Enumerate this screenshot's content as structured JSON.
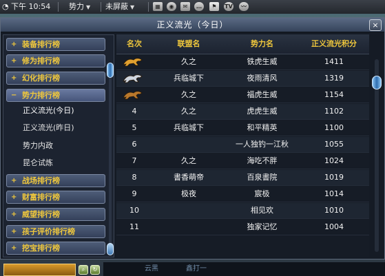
{
  "topbar": {
    "time": "下午 10:54",
    "faction": "势力",
    "status": "未屏蔽",
    "icons": [
      "keyboard-icon",
      "settings-icon",
      "mail-icon",
      "chat-icon",
      "pvp-icon",
      "tv-icon",
      "wave-icon"
    ],
    "icon_texts": {
      "tv": "TV"
    }
  },
  "panel": {
    "title": "正义流光（今日）",
    "close_label": "×"
  },
  "sidebar": {
    "categories": [
      {
        "sign": "+",
        "label": "装备排行榜"
      },
      {
        "sign": "+",
        "label": "修为排行榜"
      },
      {
        "sign": "+",
        "label": "幻化排行榜"
      },
      {
        "sign": "−",
        "label": "势力排行榜"
      },
      {
        "sign": "+",
        "label": "战场排行榜"
      },
      {
        "sign": "+",
        "label": "财富排行榜"
      },
      {
        "sign": "+",
        "label": "威望排行榜"
      },
      {
        "sign": "+",
        "label": "孩子评价排行榜"
      },
      {
        "sign": "+",
        "label": "挖宝排行榜"
      }
    ],
    "subitems": [
      "正义流光(今日)",
      "正义流光(昨日)",
      "势力内政",
      "昆仑试炼"
    ]
  },
  "table": {
    "headers": [
      "名次",
      "联盟名",
      "势力名",
      "正义流光积分"
    ],
    "rows": [
      {
        "rank": "1",
        "medal": "gold",
        "alliance": "久之",
        "faction": "铁虎生威",
        "score": "1411"
      },
      {
        "rank": "2",
        "medal": "silver",
        "alliance": "兵临城下",
        "faction": "夜雨清风",
        "score": "1319"
      },
      {
        "rank": "3",
        "medal": "bronze",
        "alliance": "久之",
        "faction": "福虎生威",
        "score": "1154"
      },
      {
        "rank": "4",
        "medal": "",
        "alliance": "久之",
        "faction": "虎虎生威",
        "score": "1102"
      },
      {
        "rank": "5",
        "medal": "",
        "alliance": "兵临城下",
        "faction": "和平精英",
        "score": "1100"
      },
      {
        "rank": "6",
        "medal": "",
        "alliance": "",
        "faction": "一人独钓一江秋",
        "score": "1055"
      },
      {
        "rank": "7",
        "medal": "",
        "alliance": "久之",
        "faction": "海吃不胖",
        "score": "1024"
      },
      {
        "rank": "8",
        "medal": "",
        "alliance": "書香萌帝",
        "faction": "百泉書院",
        "score": "1019"
      },
      {
        "rank": "9",
        "medal": "",
        "alliance": "极夜",
        "faction": "宸极",
        "score": "1014"
      },
      {
        "rank": "10",
        "medal": "",
        "alliance": "",
        "faction": "相见欢",
        "score": "1010"
      },
      {
        "rank": "11",
        "medal": "",
        "alliance": "",
        "faction": "独家记忆",
        "score": "1004"
      }
    ]
  },
  "colors": {
    "accent": "#f0c83c",
    "gold_medal": "#e0a030",
    "silver_medal": "#cfd6e0",
    "bronze_medal": "#b9782c"
  },
  "hud": {
    "text_left": "云黑",
    "text_right": "鑫打一"
  }
}
